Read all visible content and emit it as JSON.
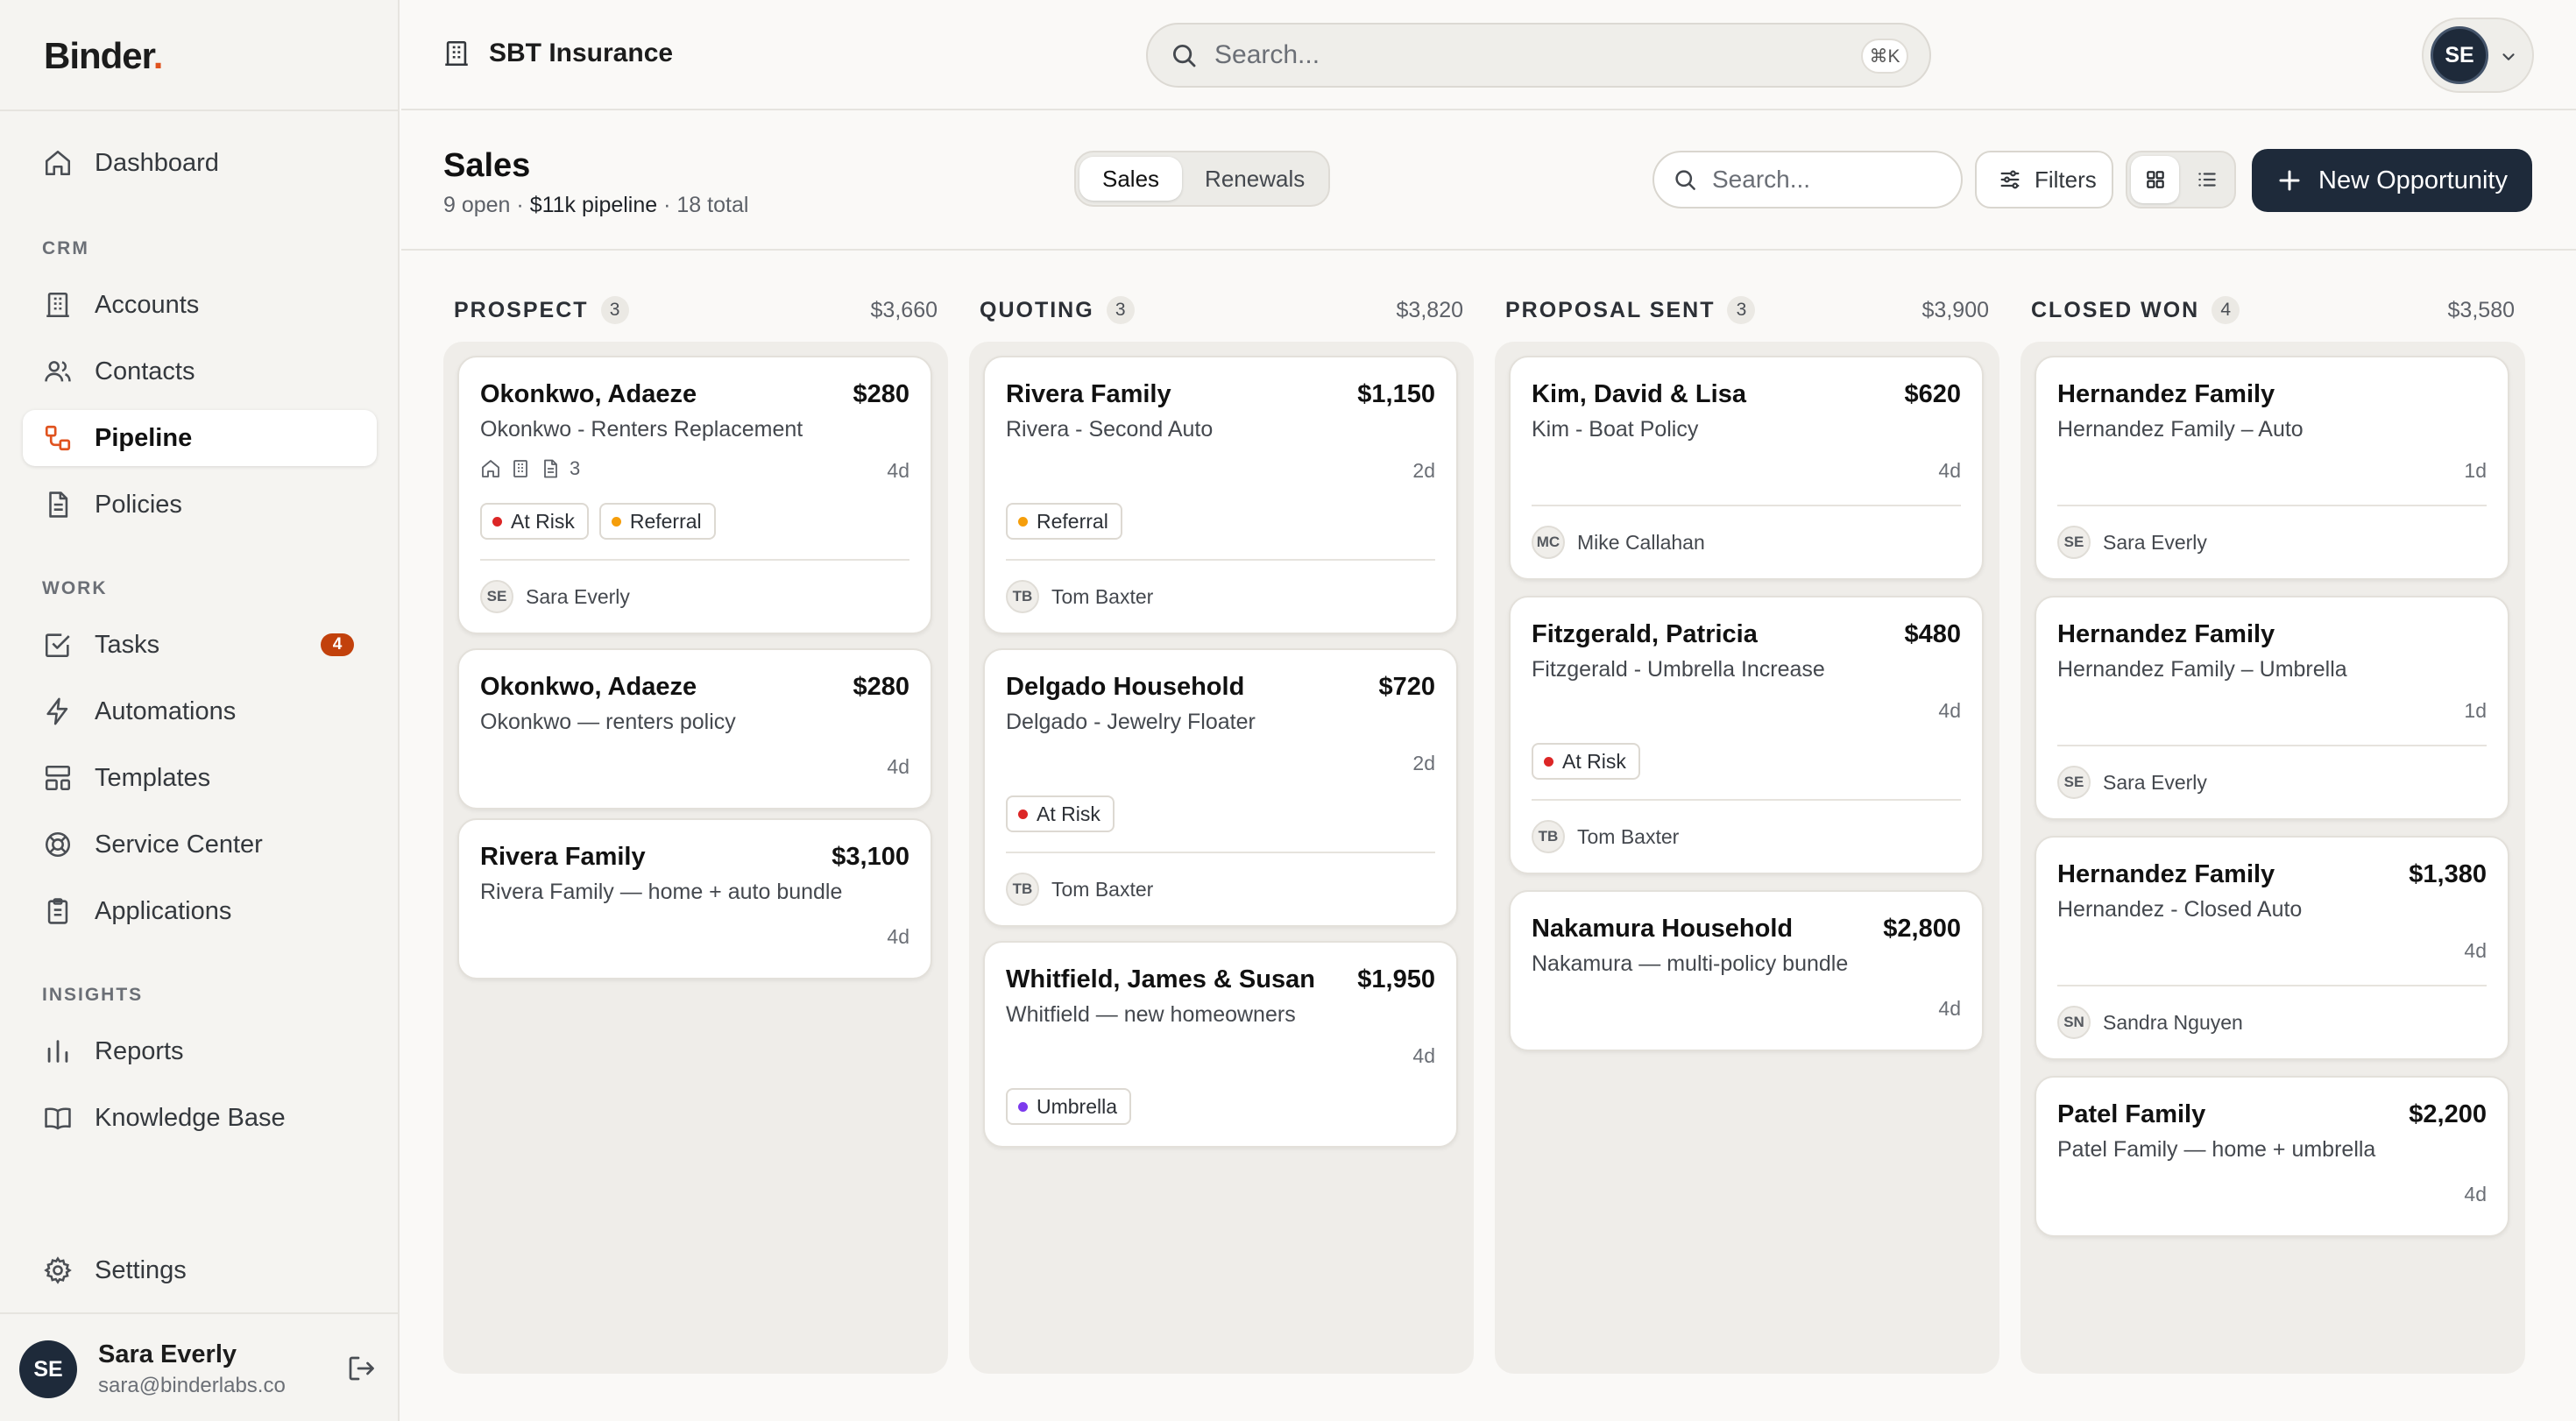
{
  "app": {
    "logo": "Binder",
    "logo_dot": "."
  },
  "sidebar": {
    "dashboard": "Dashboard",
    "crm_label": "CRM",
    "accounts": "Accounts",
    "contacts": "Contacts",
    "pipeline": "Pipeline",
    "policies": "Policies",
    "work_label": "WORK",
    "tasks": "Tasks",
    "tasks_badge": "4",
    "automations": "Automations",
    "templates": "Templates",
    "service_center": "Service Center",
    "applications": "Applications",
    "insights_label": "INSIGHTS",
    "reports": "Reports",
    "knowledge_base": "Knowledge Base",
    "settings": "Settings",
    "user": {
      "initials": "SE",
      "name": "Sara Everly",
      "email": "sara@binderlabs.co"
    }
  },
  "topbar": {
    "org_name": "SBT Insurance",
    "search_placeholder": "Search...",
    "search_shortcut": "⌘K",
    "user_initials": "SE"
  },
  "page": {
    "title": "Sales",
    "stats": {
      "open": "9 open",
      "sep1": " · ",
      "pipeline": "$11k pipeline",
      "sep2": " · ",
      "total": "18 total"
    },
    "tabs": {
      "sales": "Sales",
      "renewals": "Renewals"
    },
    "search_placeholder": "Search...",
    "filters": "Filters",
    "new_button": "New Opportunity"
  },
  "colors": {
    "accent": "#e0531f",
    "primary": "#1e2a3a",
    "at_risk": "#dc2626",
    "referral": "#f59e0b",
    "umbrella": "#7c3aed"
  },
  "board": {
    "prospect": {
      "title": "PROSPECT",
      "count": "3",
      "total": "$3,660",
      "cards": [
        {
          "name": "Okonkwo, Adaeze",
          "amount": "$280",
          "subtitle": "Okonkwo - Renters Replacement",
          "doc_count": "3",
          "age": "4d",
          "tag1": "At Risk",
          "tag2": "Referral",
          "owner_initials": "SE",
          "owner": "Sara Everly"
        },
        {
          "name": "Okonkwo, Adaeze",
          "amount": "$280",
          "subtitle": "Okonkwo — renters policy",
          "age": "4d"
        },
        {
          "name": "Rivera Family",
          "amount": "$3,100",
          "subtitle": "Rivera Family — home + auto bundle",
          "age": "4d"
        }
      ]
    },
    "quoting": {
      "title": "QUOTING",
      "count": "3",
      "total": "$3,820",
      "cards": [
        {
          "name": "Rivera Family",
          "amount": "$1,150",
          "subtitle": "Rivera - Second Auto",
          "age": "2d",
          "tag1": "Referral",
          "owner_initials": "TB",
          "owner": "Tom Baxter"
        },
        {
          "name": "Delgado Household",
          "amount": "$720",
          "subtitle": "Delgado - Jewelry Floater",
          "age": "2d",
          "tag1": "At Risk",
          "owner_initials": "TB",
          "owner": "Tom Baxter"
        },
        {
          "name": "Whitfield, James & Susan",
          "amount": "$1,950",
          "subtitle": "Whitfield — new homeowners",
          "age": "4d",
          "tag1": "Umbrella"
        }
      ]
    },
    "proposal": {
      "title": "PROPOSAL SENT",
      "count": "3",
      "total": "$3,900",
      "cards": [
        {
          "name": "Kim, David & Lisa",
          "amount": "$620",
          "subtitle": "Kim - Boat Policy",
          "age": "4d",
          "owner_initials": "MC",
          "owner": "Mike Callahan"
        },
        {
          "name": "Fitzgerald, Patricia",
          "amount": "$480",
          "subtitle": "Fitzgerald - Umbrella Increase",
          "age": "4d",
          "tag1": "At Risk",
          "owner_initials": "TB",
          "owner": "Tom Baxter"
        },
        {
          "name": "Nakamura Household",
          "amount": "$2,800",
          "subtitle": "Nakamura — multi-policy bundle",
          "age": "4d"
        }
      ]
    },
    "won": {
      "title": "CLOSED WON",
      "count": "4",
      "total": "$3,580",
      "cards": [
        {
          "name": "Hernandez Family",
          "subtitle": "Hernandez Family – Auto",
          "age": "1d",
          "owner_initials": "SE",
          "owner": "Sara Everly"
        },
        {
          "name": "Hernandez Family",
          "subtitle": "Hernandez Family – Umbrella",
          "age": "1d",
          "owner_initials": "SE",
          "owner": "Sara Everly"
        },
        {
          "name": "Hernandez Family",
          "amount": "$1,380",
          "subtitle": "Hernandez - Closed Auto",
          "age": "4d",
          "owner_initials": "SN",
          "owner": "Sandra Nguyen"
        },
        {
          "name": "Patel Family",
          "amount": "$2,200",
          "subtitle": "Patel Family — home + umbrella",
          "age": "4d"
        }
      ]
    }
  }
}
